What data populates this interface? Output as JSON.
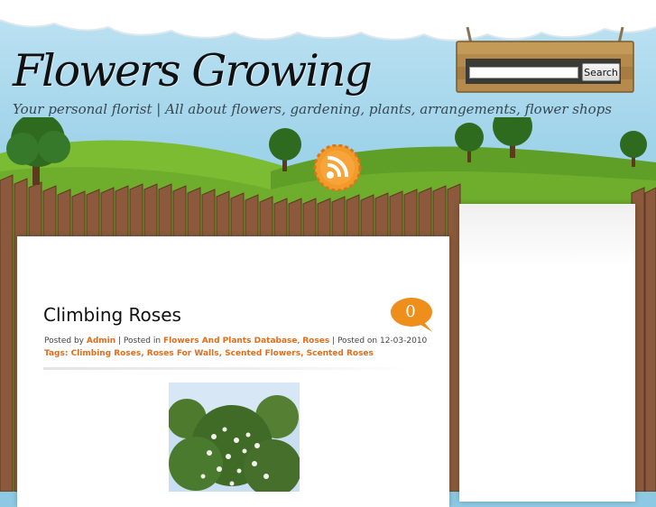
{
  "header": {
    "site_title": "Flowers Growing",
    "tagline": "Your personal florist | All about flowers, gardening, plants, arrangements, flower shops"
  },
  "search": {
    "value": "",
    "placeholder": "",
    "button_label": "Search"
  },
  "icons": {
    "rss": "rss-feed-icon"
  },
  "post": {
    "title": "Climbing Roses",
    "comment_count": "0",
    "posted_by_prefix": "Posted by",
    "author": "Admin",
    "posted_in_prefix": "| Posted in",
    "categories": [
      "Flowers And Plants Database",
      "Roses"
    ],
    "category_separator": ",",
    "posted_on_prefix": "| Posted on",
    "date": "12-03-2010",
    "tags_label": "Tags:",
    "tags": [
      "Climbing Roses",
      "Roses For Walls",
      "Scented Flowers",
      "Scented Roses"
    ],
    "tag_separator": ","
  },
  "colors": {
    "link": "#e26d1a",
    "sky": "#8cc8e2",
    "grass": "#6fae2c",
    "fence": "#8b5a3c"
  }
}
